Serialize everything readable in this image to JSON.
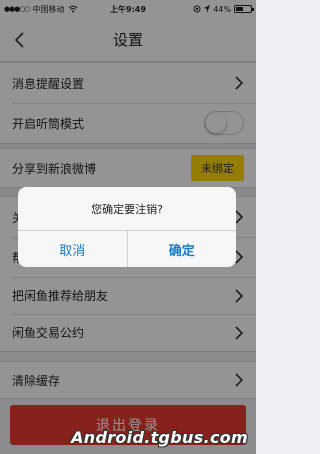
{
  "status_bar": {
    "signal_dots": "●●●○○",
    "carrier": "中国移动",
    "wifi_icon": "wifi-icon",
    "time": "上午9:49",
    "battery_percent": "44%",
    "battery_level": 0.44
  },
  "nav": {
    "title": "设置",
    "back_icon": "chevron-left-icon"
  },
  "settings": {
    "notification": "消息提醒设置",
    "earpiece_mode": "开启听筒模式",
    "earpiece_enabled": false,
    "share_weibo": "分享到新浪微博",
    "weibo_status": "未绑定",
    "about_partial": "关",
    "help_partial": "帮",
    "recommend": "把闲鱼推荐给朋友",
    "agreement": "闲鱼交易公约",
    "clear_cache": "清除缓存"
  },
  "logout_label": "退出登录",
  "dialog": {
    "message": "您确定要注销?",
    "cancel": "取消",
    "confirm": "确定"
  },
  "watermark": "Android.tgbus.com",
  "colors": {
    "accent_blue": "#1a7cc9",
    "badge_yellow": "#ffd800",
    "logout_red": "#e83a30"
  }
}
